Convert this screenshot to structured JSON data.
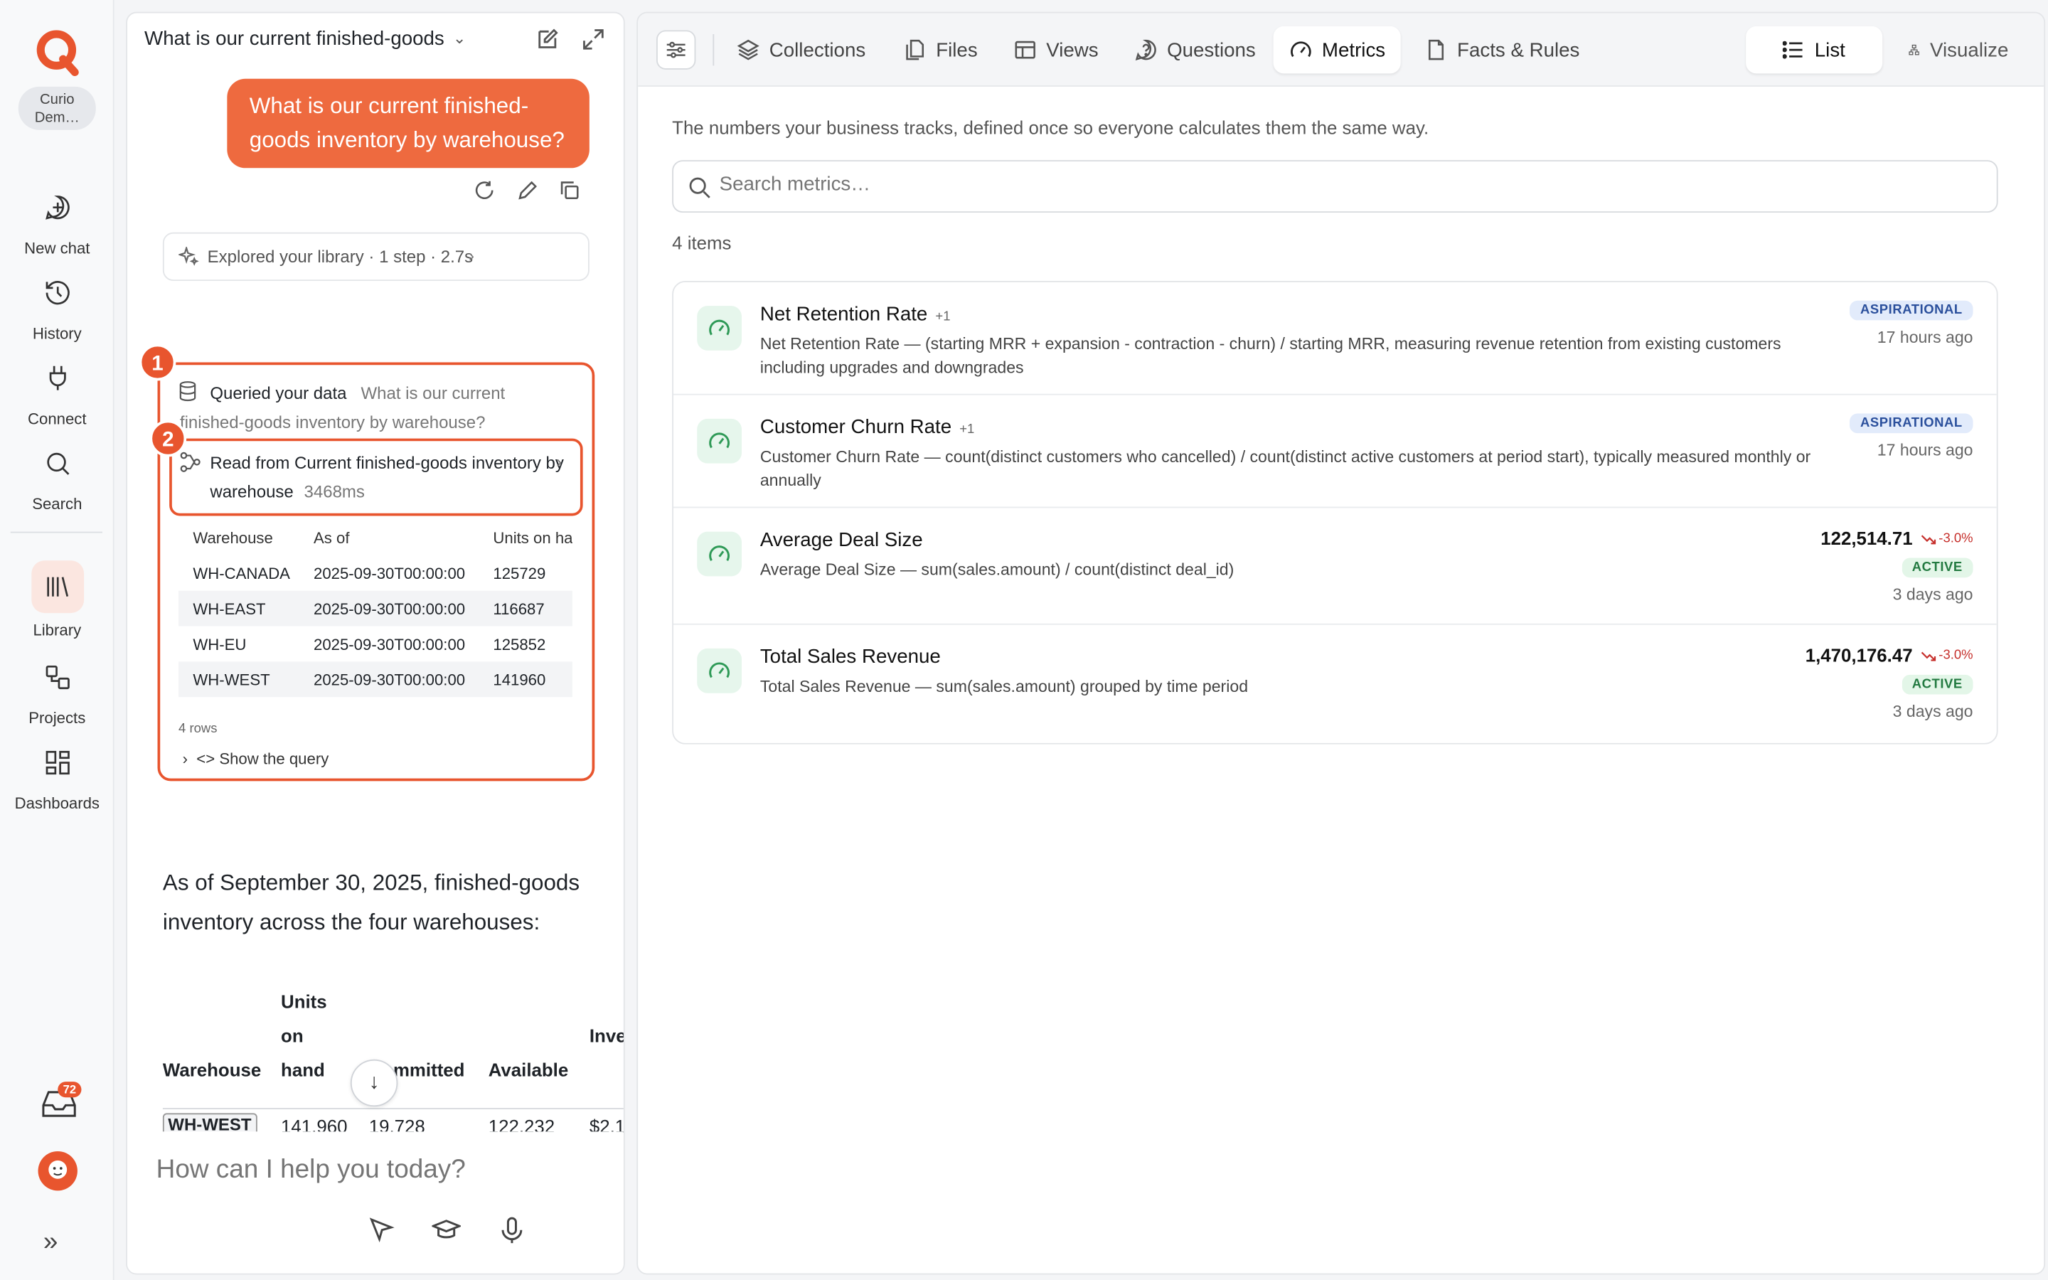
{
  "rail": {
    "workspace": "Curio Dem…",
    "items": [
      {
        "label": "New chat",
        "icon": "new-chat-icon"
      },
      {
        "label": "History",
        "icon": "history-icon"
      },
      {
        "label": "Connect",
        "icon": "plug-icon"
      },
      {
        "label": "Search",
        "icon": "search-icon"
      },
      {
        "label": "Library",
        "icon": "library-icon"
      },
      {
        "label": "Projects",
        "icon": "projects-icon"
      },
      {
        "label": "Dashboards",
        "icon": "dashboards-icon"
      }
    ],
    "inbox_count": "72"
  },
  "chat": {
    "title": "What is our current finished-goods",
    "user_message": "What is our current finished-goods inventory by warehouse?",
    "explored": "Explored your library · 1 step · 2.7s",
    "markers": [
      "1",
      "2"
    ],
    "queried_label": "Queried your data",
    "queried_text": "What is our current finished-goods inventory by warehouse?",
    "read_label": "Read from Current finished-goods inventory by warehouse",
    "read_ms": "3468ms",
    "result_table": {
      "headers": [
        "Warehouse",
        "As of",
        "Units on hand"
      ],
      "rows": [
        [
          "WH-CANADA",
          "2025-09-30T00:00:00",
          "125729"
        ],
        [
          "WH-EAST",
          "2025-09-30T00:00:00",
          "116687"
        ],
        [
          "WH-EU",
          "2025-09-30T00:00:00",
          "125852"
        ],
        [
          "WH-WEST",
          "2025-09-30T00:00:00",
          "141960"
        ]
      ],
      "row_count": "4 rows"
    },
    "show_query": "Show the query",
    "answer": "As of September 30, 2025, finished-goods inventory across the four warehouses:",
    "answer_table": {
      "headers": [
        "Warehouse",
        "Units on hand",
        "Committed",
        "Available",
        "Inventory value"
      ],
      "first_row": [
        "WH-WEST",
        "141,960",
        "19,728",
        "122,232",
        "$2,1"
      ]
    },
    "prompt_placeholder": "How can I help you today?"
  },
  "tabs": [
    {
      "label": "Collections",
      "icon": "layers-icon"
    },
    {
      "label": "Files",
      "icon": "files-icon"
    },
    {
      "label": "Views",
      "icon": "table-icon"
    },
    {
      "label": "Questions",
      "icon": "question-icon"
    },
    {
      "label": "Metrics",
      "icon": "gauge-icon",
      "active": true
    },
    {
      "label": "Facts & Rules",
      "icon": "document-icon"
    }
  ],
  "view_toggle": {
    "list": "List",
    "visualize": "Visualize"
  },
  "metrics_page": {
    "description": "The numbers your business tracks, defined once so everyone calculates them the same way.",
    "search_placeholder": "Search metrics…",
    "count": "4 items",
    "metrics": [
      {
        "name": "Net Retention Rate",
        "plus": "+1",
        "description": "Net Retention Rate — (starting MRR + expansion - contraction - churn) / starting MRR, measuring revenue retention from existing customers including upgrades and downgrades",
        "status": "ASPIRATIONAL",
        "updated": "17 hours ago"
      },
      {
        "name": "Customer Churn Rate",
        "plus": "+1",
        "description": "Customer Churn Rate — count(distinct customers who cancelled) / count(distinct active customers at period start), typically measured monthly or annually",
        "status": "ASPIRATIONAL",
        "updated": "17 hours ago"
      },
      {
        "name": "Average Deal Size",
        "plus": "",
        "description": "Average Deal Size — sum(sales.amount) / count(distinct deal_id)",
        "value": "122,514.71",
        "change": "-3.0%",
        "status": "ACTIVE",
        "updated": "3 days ago"
      },
      {
        "name": "Total Sales Revenue",
        "plus": "",
        "description": "Total Sales Revenue — sum(sales.amount) grouped by time period",
        "value": "1,470,176.47",
        "change": "-3.0%",
        "status": "ACTIVE",
        "updated": "3 days ago"
      }
    ]
  },
  "colors": {
    "accent": "#e8552e",
    "bubble": "#ee6a3f",
    "metric_icon_bg": "#e6f6ec",
    "aspirational": "#2a4f9c",
    "active": "#237a41",
    "negative": "#c6302c"
  }
}
